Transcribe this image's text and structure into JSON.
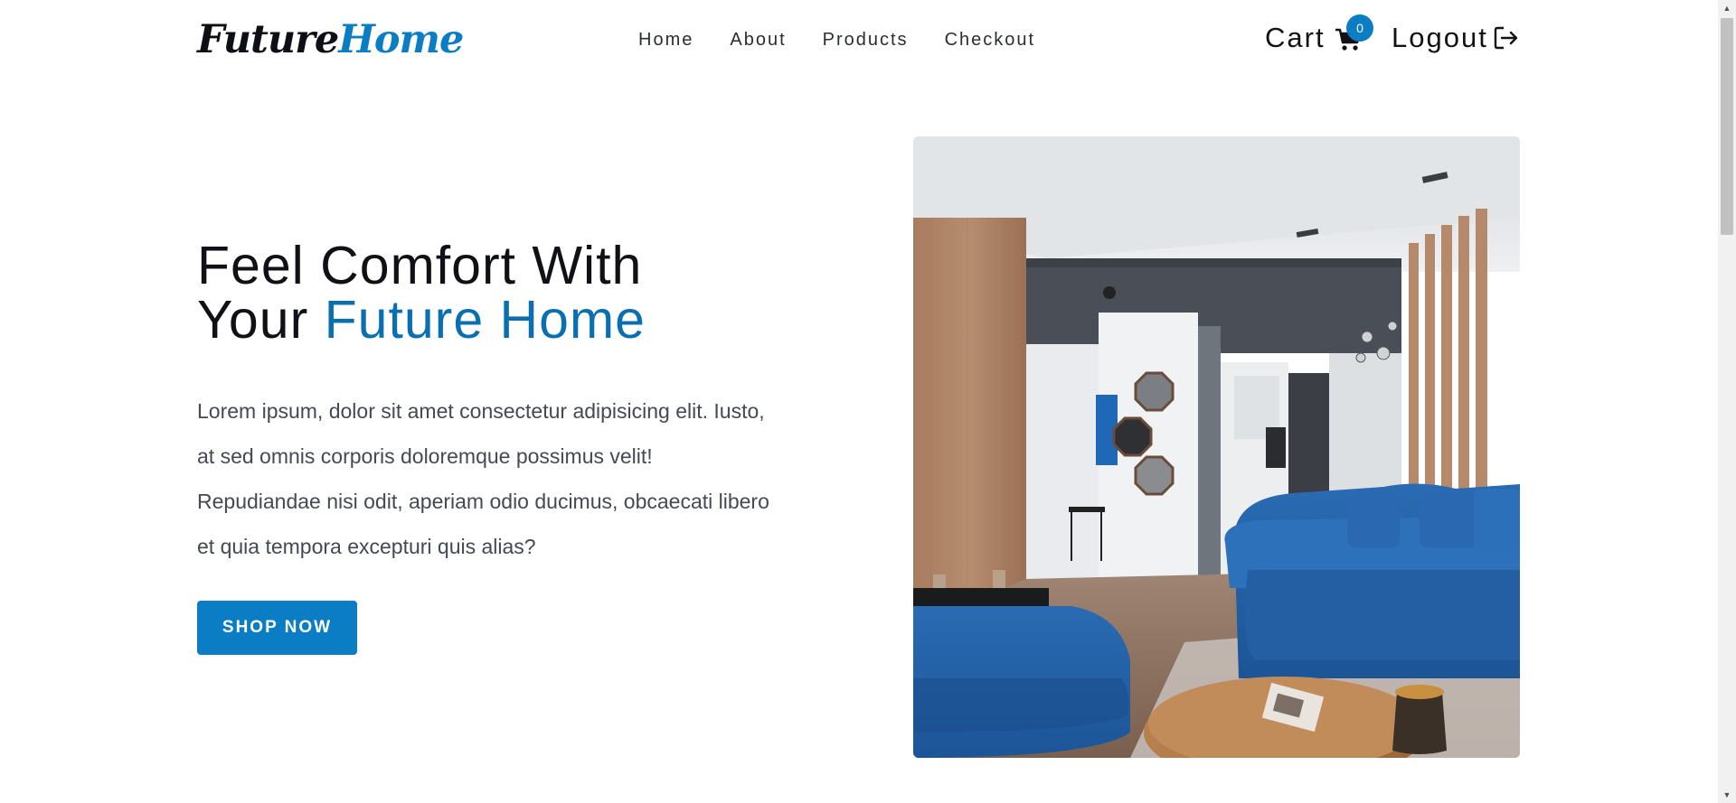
{
  "brand": {
    "part1": "Future",
    "part2": "Home"
  },
  "nav": {
    "links": [
      {
        "label": "Home"
      },
      {
        "label": "About"
      },
      {
        "label": "Products"
      },
      {
        "label": "Checkout"
      }
    ],
    "cart_label": "Cart",
    "cart_count": "0",
    "logout_label": "Logout"
  },
  "hero": {
    "title_line1": "Feel Comfort With",
    "title_line2_prefix": "Your ",
    "title_line2_accent": "Future Home",
    "paragraph": "Lorem ipsum, dolor sit amet consectetur adipisicing elit. Iusto, at sed omnis corporis doloremque possimus velit! Repudiandae nisi odit, aperiam odio ducimus, obcaecati libero et quia tempora excepturi quis alias?",
    "button_label": "SHOP NOW"
  },
  "colors": {
    "accent": "#0a7dc4",
    "title_accent": "#0a6fb0",
    "text_dark": "#0f1116",
    "text_muted": "#444955"
  },
  "icons": [
    "cart-icon",
    "logout-icon",
    "chevron-up-icon",
    "chevron-down-icon"
  ]
}
